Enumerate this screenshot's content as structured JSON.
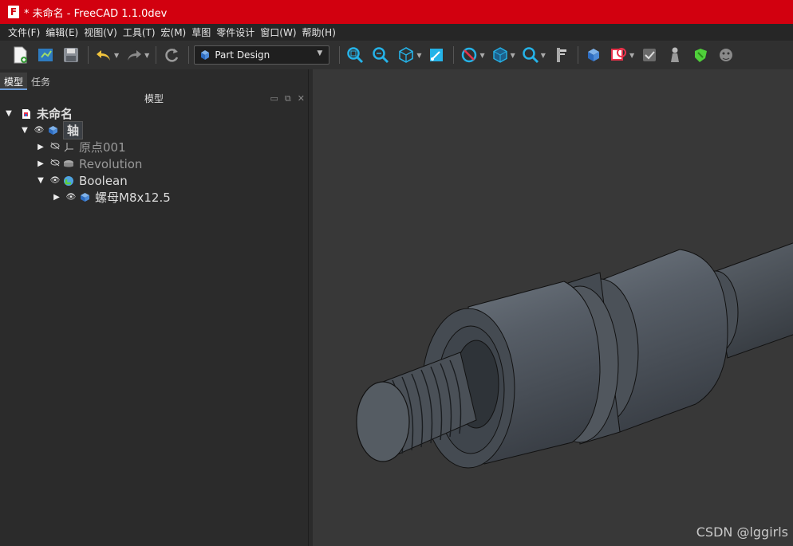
{
  "titlebar": {
    "title": "* 未命名 - FreeCAD 1.1.0dev",
    "logo_letter": "F"
  },
  "menu": [
    "文件(F)",
    "编辑(E)",
    "视图(V)",
    "工具(T)",
    "宏(M)",
    "草图",
    "零件设计",
    "窗口(W)",
    "帮助(H)"
  ],
  "toolbar": {
    "workbench": "Part Design"
  },
  "panel": {
    "tabs": [
      "模型",
      "任务"
    ],
    "title": "模型"
  },
  "tree": {
    "root": "未命名",
    "body": "轴",
    "origin": "原点001",
    "revolution": "Revolution",
    "boolean": "Boolean",
    "nut": "螺母M8x12.5"
  },
  "watermark": "CSDN @lggirls",
  "colors": {
    "titlebar": "#d2000f",
    "part_body": "#4a5058"
  }
}
